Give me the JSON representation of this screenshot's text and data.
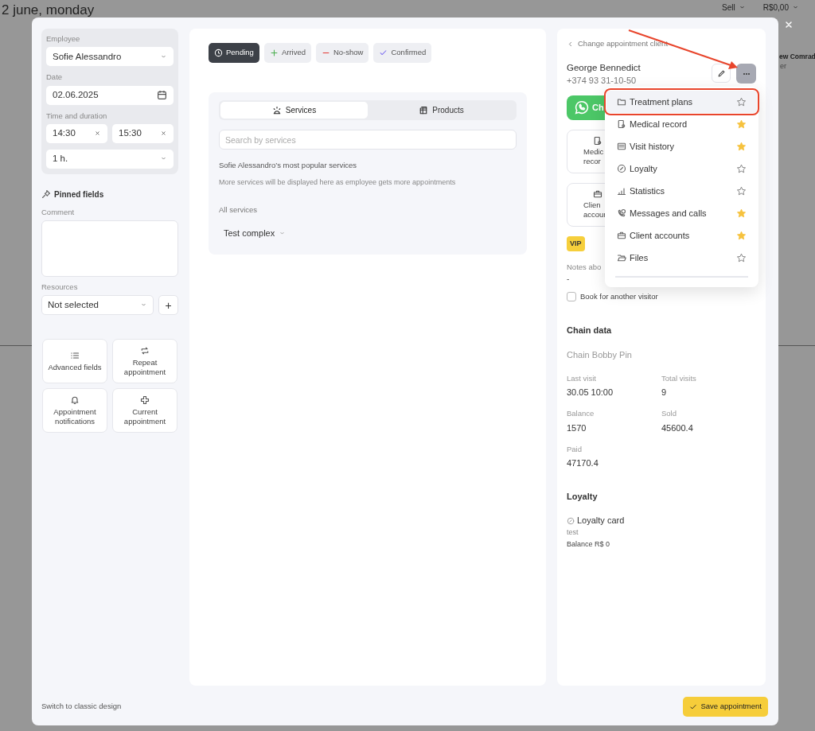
{
  "background": {
    "title": "2 june, monday",
    "sell": "Sell",
    "balance": "R$0,00",
    "peek_name": "ew Comrad",
    "peek_sub": "er"
  },
  "employee": {
    "label": "Employee",
    "value": "Sofie Alessandro"
  },
  "date": {
    "label": "Date",
    "value": "02.06.2025"
  },
  "time": {
    "label": "Time and duration",
    "start": "14:30",
    "end": "15:30",
    "duration": "1 h."
  },
  "pinned_title": "Pinned fields",
  "comment": {
    "label": "Comment"
  },
  "resources": {
    "label": "Resources",
    "value": "Not selected",
    "add": "+"
  },
  "actions": [
    {
      "kind": "list",
      "label": "Advanced fields"
    },
    {
      "kind": "repeat",
      "label": "Repeat appointment"
    },
    {
      "kind": "bell",
      "label": "Appointment notifications"
    },
    {
      "kind": "plus",
      "label": "Current appointment"
    }
  ],
  "statuses": [
    {
      "kind": "pending",
      "label": "Pending",
      "selected": true
    },
    {
      "kind": "arrived",
      "label": "Arrived",
      "selected": false
    },
    {
      "kind": "noshow",
      "label": "No-show",
      "selected": false
    },
    {
      "kind": "confirmed",
      "label": "Confirmed",
      "selected": false
    }
  ],
  "item_tabs": [
    {
      "kind": "services",
      "label": "Services",
      "selected": true
    },
    {
      "kind": "products",
      "label": "Products",
      "selected": false
    }
  ],
  "search": {
    "placeholder": "Search by services"
  },
  "popular_title": "Sofie Alessandro’s most popular services",
  "popular_hint": "More services will be displayed here as employee gets more appointments",
  "all_services": "All services",
  "service_group": "Test complex",
  "client": {
    "back_link": "Change appointment client",
    "name": "George Bennedict",
    "phone": "+374 93 31-10-50",
    "chat_button": "Ch",
    "tiles": [
      {
        "kind": "medical",
        "lines": [
          "Medic",
          "recor"
        ]
      },
      {
        "kind": "accounts",
        "lines": [
          "Clien",
          "accour"
        ]
      }
    ],
    "tag": "VIP",
    "notes_label": "Notes abo",
    "notes_value": "-",
    "book_other": {
      "label": "Book for another visitor",
      "checked": false
    }
  },
  "chain": {
    "title": "Chain data",
    "name": "Chain Bobby Pin",
    "stats": [
      {
        "label": "Last visit",
        "value": "30.05 10:00"
      },
      {
        "label": "Total visits",
        "value": "9"
      },
      {
        "label": "Balance",
        "value": "1570"
      },
      {
        "label": "Sold",
        "value": "45600.4"
      },
      {
        "label": "Paid",
        "value": "47170.4"
      }
    ]
  },
  "loyalty": {
    "title": "Loyalty",
    "card": "Loyalty card",
    "card_sub": "test",
    "balance": "Balance R$ 0"
  },
  "menu": {
    "items": [
      {
        "kind": "folder",
        "label": "Treatment plans",
        "starred": false,
        "highlighted": true
      },
      {
        "kind": "medical",
        "label": "Medical record",
        "starred": true,
        "highlighted": false
      },
      {
        "kind": "history",
        "label": "Visit history",
        "starred": true,
        "highlighted": false
      },
      {
        "kind": "loyalty",
        "label": "Loyalty",
        "starred": false,
        "highlighted": false
      },
      {
        "kind": "stats",
        "label": "Statistics",
        "starred": false,
        "highlighted": false
      },
      {
        "kind": "calls",
        "label": "Messages and calls",
        "starred": true,
        "highlighted": false
      },
      {
        "kind": "accounts",
        "label": "Client accounts",
        "starred": true,
        "highlighted": false
      },
      {
        "kind": "files",
        "label": "Files",
        "starred": false,
        "highlighted": false
      }
    ]
  },
  "footer": {
    "switch_link": "Switch to classic design",
    "save_button": "Save appointment"
  }
}
